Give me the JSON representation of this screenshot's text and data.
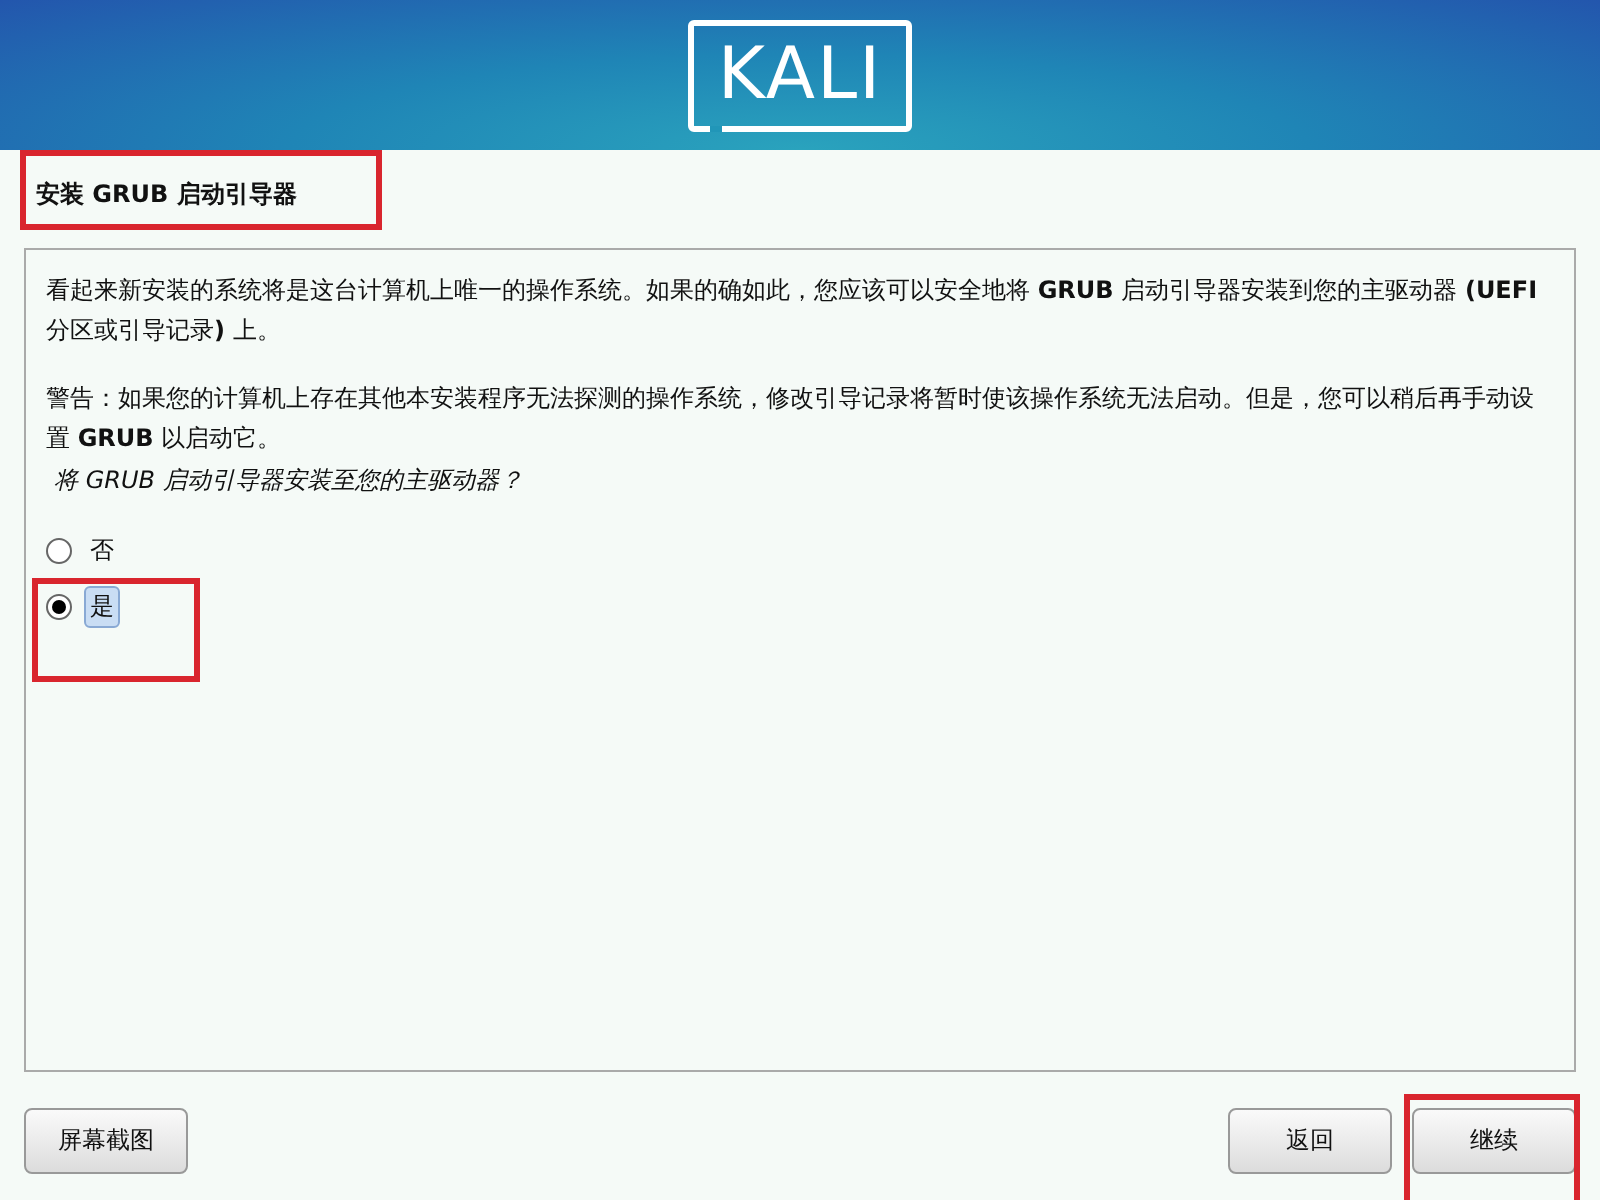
{
  "header": {
    "logo": "KALI"
  },
  "title": {
    "text": "安装 GRUB 启动引导器",
    "highlighted": true
  },
  "paragraphs": [
    "看起来新安装的系统将是这台计算机上唯一的操作系统。如果的确如此，您应该可以安全地将 **GRUB** 启动引导器安装到您的主驱动器 **(UEFI** 分区或引导记录**)** 上。",
    "警告：如果您的计算机上存在其他本安装程序无法探测的操作系统，修改引导记录将暂时使该操作系统无法启动。但是，您可以稍后再手动设置 **GRUB** 以启动它。"
  ],
  "question": "将 GRUB 启动引导器安装至您的主驱动器？",
  "options": [
    {
      "label": "否",
      "selected": false,
      "highlighted": false
    },
    {
      "label": "是",
      "selected": true,
      "highlighted": true
    }
  ],
  "buttons": [
    {
      "label": "屏幕截图",
      "kind": "left",
      "highlighted": false
    },
    {
      "label": "返回",
      "kind": "right",
      "highlighted": false
    },
    {
      "label": "继续",
      "kind": "right",
      "highlighted": true
    }
  ]
}
